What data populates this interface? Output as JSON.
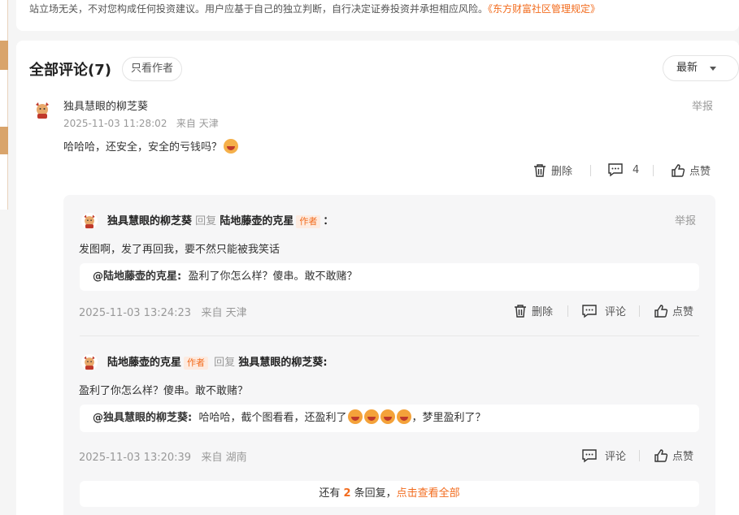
{
  "disclaimer": {
    "text": "站立场无关，不对您构成任何投资建议。用户应基于自己的独立判断，自行决定证券投资并承担相应风险。",
    "link": "《东方财富社区管理规定》"
  },
  "comments_header": {
    "title": "全部评论(7)",
    "author_only_label": "只看作者",
    "sort_label": "最新"
  },
  "comment": {
    "user": "独具慧眼的柳芝葵",
    "timestamp": "2025-11-03 11:28:02",
    "location": "来自 天津",
    "text": "哈哈哈，还安全，安全的亏钱吗？",
    "report_label": "举报",
    "delete_label": "删除",
    "reply_count": "4",
    "like_label": "点赞"
  },
  "replies": [
    {
      "from": "独具慧眼的柳芝葵",
      "reply_word": "回复",
      "to": "陆地藤壶的克星",
      "to_tag": "作者",
      "colon": "：",
      "text": "发图啊，发了再回我，要不然只能被我笑话",
      "quote_user": "@陆地藤壶的克星:",
      "quote_text": "盈利了你怎么样？傻串。敢不敢赌？",
      "timestamp": "2025-11-03 13:24:23",
      "location": "来自 天津",
      "report_label": "举报",
      "delete_label": "删除",
      "comment_label": "评论",
      "like_label": "点赞"
    },
    {
      "from": "陆地藤壶的克星",
      "from_tag": "作者",
      "reply_word": "回复",
      "to": "独具慧眼的柳芝葵:",
      "text": "盈利了你怎么样？傻串。敢不敢赌？",
      "quote_user": "@独具慧眼的柳芝葵:",
      "quote_text": "哈哈哈，截个图看看，还盈利了",
      "quote_tail": "，梦里盈利了？",
      "timestamp": "2025-11-03 13:20:39",
      "location": "来自 湖南",
      "comment_label": "评论",
      "like_label": "点赞"
    }
  ],
  "more": {
    "prefix": "还有",
    "count": "2",
    "suffix": "条回复，",
    "link": "点击查看全部"
  },
  "colors": {
    "accent": "#f26b1d",
    "muted": "#999999"
  }
}
